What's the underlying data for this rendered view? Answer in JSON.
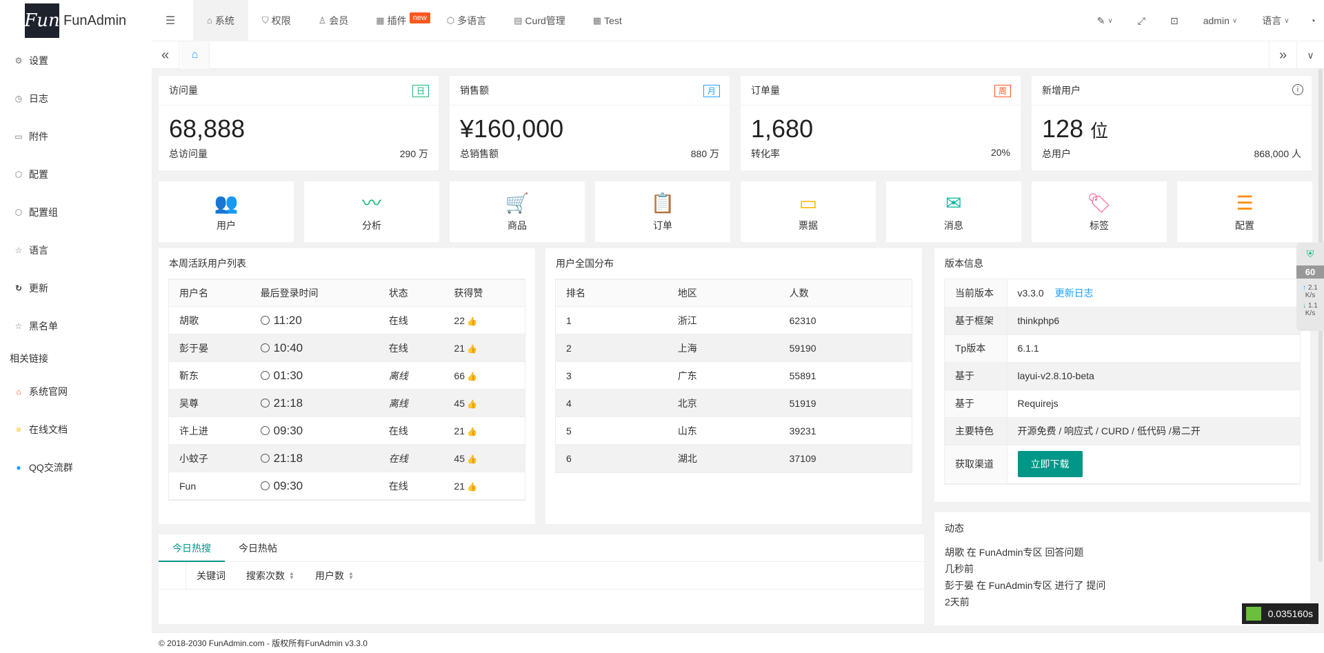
{
  "app": {
    "logo_mark": "Fun",
    "logo_text": "FunAdmin"
  },
  "top_nav": {
    "items": [
      {
        "label": "系统",
        "icon": "home-icon"
      },
      {
        "label": "权限",
        "icon": "shield-icon"
      },
      {
        "label": "会员",
        "icon": "user-icon"
      },
      {
        "label": "插件",
        "icon": "grid-icon",
        "badge": "new"
      },
      {
        "label": "多语言",
        "icon": "cube-icon"
      },
      {
        "label": "Curd管理",
        "icon": "file-icon"
      },
      {
        "label": "Test",
        "icon": "grid-icon"
      }
    ],
    "user": "admin",
    "language": "语言"
  },
  "sidebar": {
    "items": [
      {
        "label": "设置",
        "icon": "gear-icon"
      },
      {
        "label": "日志",
        "icon": "clock-icon"
      },
      {
        "label": "附件",
        "icon": "image-icon"
      },
      {
        "label": "配置",
        "icon": "cube-icon"
      },
      {
        "label": "配置组",
        "icon": "cube-icon"
      },
      {
        "label": "语言",
        "icon": "star-icon"
      },
      {
        "label": "更新",
        "icon": "refresh-icon"
      },
      {
        "label": "黑名单",
        "icon": "star-icon"
      }
    ],
    "section": "相关链接",
    "links": [
      {
        "label": "系统官网",
        "icon": "home-icon"
      },
      {
        "label": "在线文档",
        "icon": "doc-icon"
      },
      {
        "label": "QQ交流群",
        "icon": "qq-icon"
      }
    ]
  },
  "stats": [
    {
      "title": "访问量",
      "tag": "日",
      "tag_color": "green",
      "value": "68,888",
      "value_unit": "",
      "foot_label": "总访问量",
      "foot_value": "290 万"
    },
    {
      "title": "销售额",
      "tag": "月",
      "tag_color": "blue",
      "value": "¥160,000",
      "value_unit": "",
      "foot_label": "总销售额",
      "foot_value": "880 万"
    },
    {
      "title": "订单量",
      "tag": "周",
      "tag_color": "red",
      "value": "1,680",
      "value_unit": "",
      "foot_label": "转化率",
      "foot_value": "20%"
    },
    {
      "title": "新增用户",
      "tag": "",
      "tag_color": "",
      "value": "128",
      "value_unit": "位",
      "foot_label": "总用户",
      "foot_value": "868,000 人"
    }
  ],
  "quick_links": [
    {
      "label": "用户",
      "icon": "users-icon",
      "color": "#1e9fff"
    },
    {
      "label": "分析",
      "icon": "pulse-icon",
      "color": "#16b777"
    },
    {
      "label": "商品",
      "icon": "cart-icon",
      "color": "#ff5722"
    },
    {
      "label": "订单",
      "icon": "clipboard-icon",
      "color": "#a233c6"
    },
    {
      "label": "票据",
      "icon": "card-icon",
      "color": "#ffb800"
    },
    {
      "label": "消息",
      "icon": "mail-icon",
      "color": "#16baaa"
    },
    {
      "label": "标签",
      "icon": "tag-icon",
      "color": "#ff5c93"
    },
    {
      "label": "配置",
      "icon": "sliders-icon",
      "color": "#ff8c00"
    }
  ],
  "active_users": {
    "title": "本周活跃用户列表",
    "columns": [
      "用户名",
      "最后登录时间",
      "状态",
      "获得赞"
    ],
    "rows": [
      {
        "name": "胡歌",
        "time": "11:20",
        "status": "在线",
        "italic": false,
        "likes": "22"
      },
      {
        "name": "彭于晏",
        "time": "10:40",
        "status": "在线",
        "italic": false,
        "likes": "21"
      },
      {
        "name": "靳东",
        "time": "01:30",
        "status": "离线",
        "italic": true,
        "likes": "66"
      },
      {
        "name": "吴尊",
        "time": "21:18",
        "status": "离线",
        "italic": true,
        "likes": "45"
      },
      {
        "name": "许上进",
        "time": "09:30",
        "status": "在线",
        "italic": false,
        "likes": "21"
      },
      {
        "name": "小蚊子",
        "time": "21:18",
        "status": "在线",
        "italic": true,
        "likes": "45"
      },
      {
        "name": "Fun",
        "time": "09:30",
        "status": "在线",
        "italic": false,
        "likes": "21"
      }
    ]
  },
  "distribution": {
    "title": "用户全国分布",
    "columns": [
      "排名",
      "地区",
      "人数"
    ],
    "rows": [
      [
        "1",
        "浙江",
        "62310"
      ],
      [
        "2",
        "上海",
        "59190"
      ],
      [
        "3",
        "广东",
        "55891"
      ],
      [
        "4",
        "北京",
        "51919"
      ],
      [
        "5",
        "山东",
        "39231"
      ],
      [
        "6",
        "湖北",
        "37109"
      ]
    ]
  },
  "version": {
    "title": "版本信息",
    "rows": [
      {
        "key": "当前版本",
        "value": "v3.3.0",
        "link": "更新日志"
      },
      {
        "key": "基于框架",
        "value": "thinkphp6"
      },
      {
        "key": "Tp版本",
        "value": "6.1.1"
      },
      {
        "key": "基于",
        "value": "layui-v2.8.10-beta"
      },
      {
        "key": "基于",
        "value": "Requirejs"
      },
      {
        "key": "主要特色",
        "value": "开源免费 / 响应式 / CURD / 低代码 /易二开"
      },
      {
        "key": "获取渠道",
        "button": "立即下载"
      }
    ]
  },
  "dynamics": {
    "title": "动态",
    "lines": [
      "胡歌 在 FunAdmin专区 回答问题",
      "几秒前",
      "彭于晏 在 FunAdmin专区 进行了 提问",
      "2天前"
    ]
  },
  "hot_tabs": {
    "tabs": [
      "今日热搜",
      "今日热帖"
    ],
    "columns": [
      "关键词",
      "搜索次数",
      "用户数"
    ]
  },
  "widget": {
    "score": "60",
    "up": "2.1",
    "down": "1.1",
    "unit": "K/s"
  },
  "timer": "0.035160s",
  "footer": "© 2018-2030 FunAdmin.com - 版权所有FunAdmin v3.3.0"
}
